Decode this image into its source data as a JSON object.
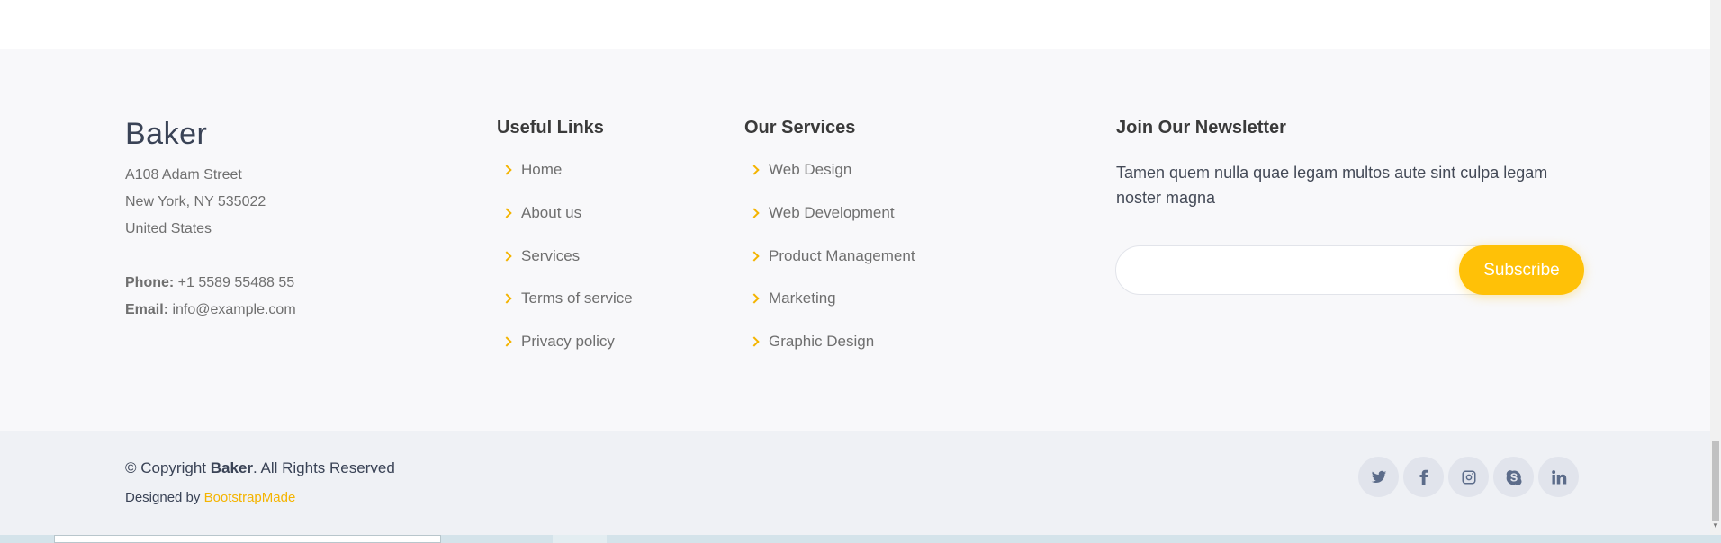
{
  "about": {
    "brand": "Baker",
    "address_line1": "A108 Adam Street",
    "address_line2": "New York, NY 535022",
    "address_line3": "United States",
    "phone_label": "Phone:",
    "phone": "+1 5589 55488 55",
    "email_label": "Email:",
    "email": "info@example.com"
  },
  "useful_links": {
    "title": "Useful Links",
    "items": [
      "Home",
      "About us",
      "Services",
      "Terms of service",
      "Privacy policy"
    ]
  },
  "services": {
    "title": "Our Services",
    "items": [
      "Web Design",
      "Web Development",
      "Product Management",
      "Marketing",
      "Graphic Design"
    ]
  },
  "newsletter": {
    "title": "Join Our Newsletter",
    "text": "Tamen quem nulla quae legam multos aute sint culpa legam noster magna",
    "input_value": "",
    "button_label": "Subscribe"
  },
  "bottom": {
    "copyright_prefix": "© Copyright ",
    "copyright_brand": "Baker",
    "copyright_suffix": ". All Rights Reserved",
    "designed_by": "Designed by ",
    "designer": "BootstrapMade"
  },
  "social": [
    "twitter-icon",
    "facebook-icon",
    "instagram-icon",
    "skype-icon",
    "linkedin-icon"
  ],
  "colors": {
    "accent": "#ffc107",
    "footer_bg": "#f8f8fa",
    "bottom_bg": "#eff1f5",
    "social_icon": "#5c6c8a"
  }
}
